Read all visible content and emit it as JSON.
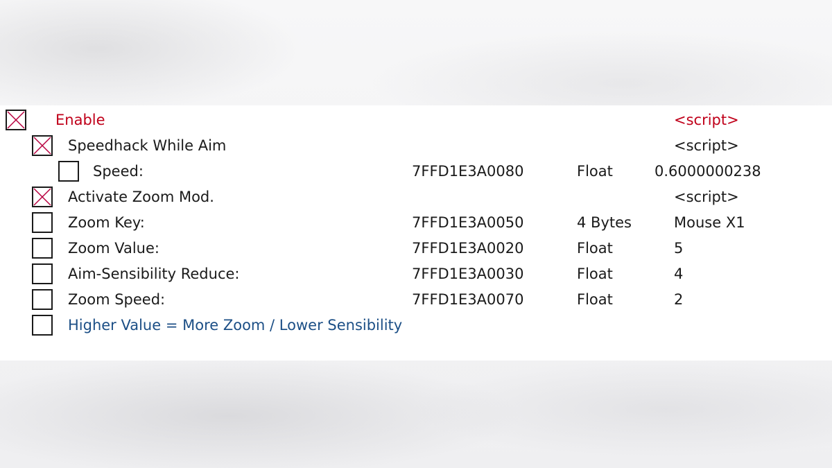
{
  "cheat_table": {
    "rows": [
      {
        "description": "Enable",
        "address": "",
        "type": "",
        "value": "<script>",
        "checked": true,
        "indent": 0,
        "color": "#c0001a"
      },
      {
        "description": "Speedhack While Aim",
        "address": "",
        "type": "",
        "value": "<script>",
        "checked": true,
        "indent": 1,
        "color": "#1a1a1a"
      },
      {
        "description": "Speed:",
        "address": "7FFD1E3A0080",
        "type": "Float",
        "value": "0.6000000238",
        "checked": false,
        "indent": 2,
        "color": "#1a1a1a"
      },
      {
        "description": "Activate Zoom Mod.",
        "address": "",
        "type": "",
        "value": "<script>",
        "checked": true,
        "indent": 1,
        "color": "#1a1a1a"
      },
      {
        "description": "Zoom Key:",
        "address": "7FFD1E3A0050",
        "type": "4 Bytes",
        "value": "Mouse X1",
        "checked": false,
        "indent": 1,
        "color": "#1a1a1a"
      },
      {
        "description": "Zoom Value:",
        "address": "7FFD1E3A0020",
        "type": "Float",
        "value": "5",
        "checked": false,
        "indent": 1,
        "color": "#1a1a1a"
      },
      {
        "description": "Aim-Sensibility Reduce:",
        "address": "7FFD1E3A0030",
        "type": "Float",
        "value": "4",
        "checked": false,
        "indent": 1,
        "color": "#1a1a1a"
      },
      {
        "description": "Zoom Speed:",
        "address": "7FFD1E3A0070",
        "type": "Float",
        "value": "2",
        "checked": false,
        "indent": 1,
        "color": "#1a1a1a"
      },
      {
        "description": "Higher Value = More Zoom / Lower Sensibility",
        "address": "",
        "type": "",
        "value": "",
        "checked": false,
        "indent": 1,
        "color": "#1c4f86"
      }
    ]
  }
}
